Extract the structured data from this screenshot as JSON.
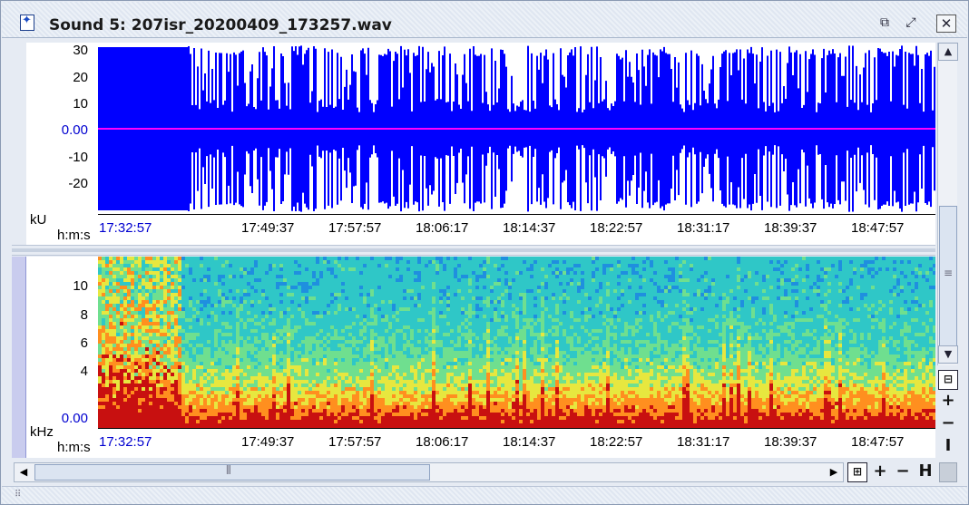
{
  "window": {
    "title": "Sound 5: 207isr_20200409_173257.wav",
    "icons": [
      "sound-file-icon",
      "minimize-icon",
      "maximize-icon",
      "close-icon"
    ]
  },
  "waveform": {
    "unit_label": "kU",
    "time_unit_label": "h:m:s",
    "y_ticks": [
      "30",
      "20",
      "10",
      "0.00",
      "-10",
      "-20"
    ],
    "zero_label": "0.00",
    "start_time": "17:32:57",
    "time_ticks": [
      "17:49:37",
      "17:57:57",
      "18:06:17",
      "18:14:37",
      "18:22:57",
      "18:31:17",
      "18:39:37",
      "18:47:57"
    ],
    "colors": {
      "wave": "#0000ff",
      "zero_line": "#ff00ff"
    }
  },
  "spectrogram": {
    "unit_label": "kHz",
    "time_unit_label": "h:m:s",
    "y_ticks": [
      "10",
      "8",
      "6",
      "4",
      "0.00"
    ],
    "start_time": "17:32:57",
    "time_ticks": [
      "17:49:37",
      "17:57:57",
      "18:06:17",
      "18:14:37",
      "18:22:57",
      "18:31:17",
      "18:39:37",
      "18:47:57"
    ]
  },
  "controls": {
    "scroll_up": "▲",
    "scroll_down": "▼",
    "scroll_left": "◀",
    "scroll_right": "▶",
    "zoom_in_v": "+",
    "zoom_out_v": "−",
    "fit_v": "I",
    "zoom_in_h": "+",
    "zoom_out_h": "−",
    "fit_h": "H"
  }
}
